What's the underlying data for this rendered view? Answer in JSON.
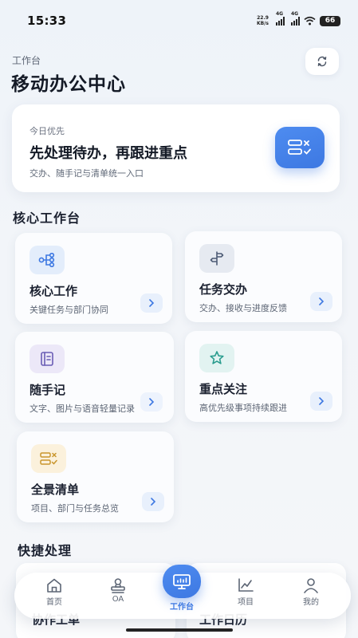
{
  "status_bar": {
    "time": "15:33",
    "net_speed_value": "22.9",
    "net_speed_unit": "KB/s",
    "signal1_tag": "4G",
    "signal2_tag": "4G",
    "battery": "66"
  },
  "header": {
    "eyebrow": "工作台",
    "title": "移动办公中心",
    "refresh_icon": "refresh-icon"
  },
  "hero": {
    "eyebrow": "今日优先",
    "title": "先处理待办，再跟进重点",
    "subtitle": "交办、随手记与清单统一入口",
    "icon": "checklist-icon"
  },
  "core_section": {
    "title": "核心工作台",
    "tiles": [
      {
        "title": "核心工作",
        "desc": "关键任务与部门协同",
        "icon": "flow-tree-icon",
        "icon_bg": "#e3edfb",
        "icon_color": "#3d78e2"
      },
      {
        "title": "任务交办",
        "desc": "交办、接收与进度反馈",
        "icon": "signpost-icon",
        "icon_bg": "#e6eaf1",
        "icon_color": "#4d5b75"
      },
      {
        "title": "随手记",
        "desc": "文字、图片与语音轻量记录",
        "icon": "notebook-icon",
        "icon_bg": "#ece8f8",
        "icon_color": "#6a5db5"
      },
      {
        "title": "重点关注",
        "desc": "高优先级事项持续跟进",
        "icon": "star-icon",
        "icon_bg": "#e2f3f1",
        "icon_color": "#2b9d8f"
      },
      {
        "title": "全景清单",
        "desc": "项目、部门与任务总览",
        "icon": "checklist-icon",
        "icon_bg": "#fbf1dc",
        "icon_color": "#c9962d"
      }
    ]
  },
  "quick_section": {
    "title": "快捷处理",
    "cards": [
      {
        "label": "协作工单"
      },
      {
        "label": "工作日历"
      }
    ]
  },
  "tabbar": {
    "items": [
      {
        "label": "首页",
        "icon": "home-icon"
      },
      {
        "label": "OA",
        "icon": "stamp-icon"
      },
      {
        "label": "工作台",
        "icon": "monitor-icon"
      },
      {
        "label": "项目",
        "icon": "chart-icon"
      },
      {
        "label": "我的",
        "icon": "user-icon"
      }
    ]
  },
  "colors": {
    "accent": "#3d78e2",
    "background": "#f2f5f9",
    "card": "#ffffff"
  }
}
